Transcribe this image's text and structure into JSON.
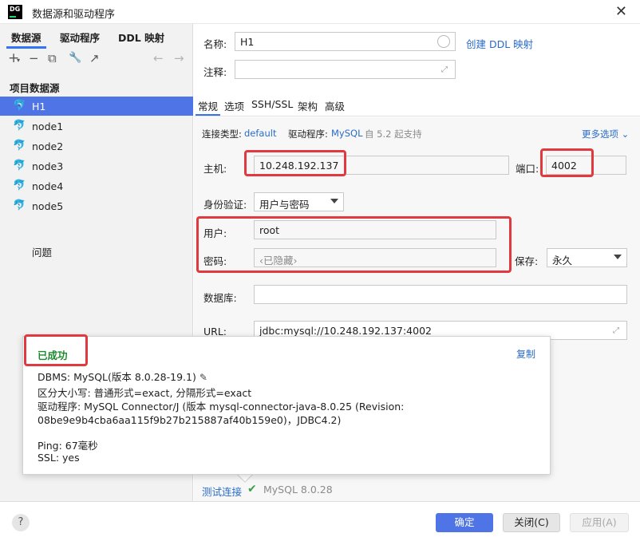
{
  "window": {
    "title": "数据源和驱动程序",
    "app_icon_text": "DG",
    "close_glyph": "✕"
  },
  "sidebar": {
    "tabs": [
      {
        "label": "数据源"
      },
      {
        "label": "驱动程序"
      },
      {
        "label": "DDL 映射"
      }
    ],
    "toolbar": {
      "add": "+",
      "add_caret": "▾",
      "remove": "−",
      "copy": "⧉",
      "settings": "🔧",
      "goto": "↗",
      "back": "←",
      "forward": "→"
    },
    "section_title": "项目数据源",
    "items": [
      {
        "label": "H1"
      },
      {
        "label": "node1"
      },
      {
        "label": "node2"
      },
      {
        "label": "node3"
      },
      {
        "label": "node4"
      },
      {
        "label": "node5"
      }
    ],
    "problems_label": "问题"
  },
  "form": {
    "name_label": "名称:",
    "name_value": "H1",
    "create_ddl_link": "创建 DDL 映射",
    "comment_label": "注释:",
    "comment_value": "",
    "tabs": [
      {
        "label": "常规"
      },
      {
        "label": "选项"
      },
      {
        "label": "SSH/SSL"
      },
      {
        "label": "架构"
      },
      {
        "label": "高级"
      }
    ],
    "conn_type_label": "连接类型:",
    "conn_type_value": "default",
    "driver_label": "驱动程序:",
    "driver_value": "MySQL",
    "driver_note": "自 5.2 起支持",
    "more_options": "更多选项",
    "host_label": "主机:",
    "host_value": "10.248.192.137",
    "port_label": "端口:",
    "port_value": "4002",
    "auth_label": "身份验证:",
    "auth_value": "用户与密码",
    "user_label": "用户:",
    "user_value": "root",
    "password_label": "密码:",
    "password_value": "‹已隐藏›",
    "save_label": "保存:",
    "save_value": "永久",
    "database_label": "数据库:",
    "database_value": "",
    "url_label": "URL:",
    "url_value": "jdbc:mysql://10.248.192.137:4002"
  },
  "popup": {
    "status": "已成功",
    "copy_link": "复制",
    "lines": [
      "DBMS: MySQL(版本 8.0.28-19.1)",
      "区分大小写: 普通形式=exact, 分隔形式=exact",
      "驱动程序: MySQL Connector/J (版本 mysql-connector-java-8.0.25 (Revision:",
      "08be9e9b4cba6aa115f9b27b215887af40b159e0)，JDBC4.2)",
      "Ping: 67毫秒",
      "SSL: yes"
    ]
  },
  "test": {
    "link": "测试连接",
    "version": "MySQL 8.0.28"
  },
  "footer": {
    "help": "?",
    "ok": "确定",
    "close": "关闭(C)",
    "apply": "应用(A)"
  },
  "colors": {
    "accent": "#4f74e6",
    "success": "#1c8a2c",
    "highlight": "#e0393f",
    "link": "#2a6bc8"
  }
}
